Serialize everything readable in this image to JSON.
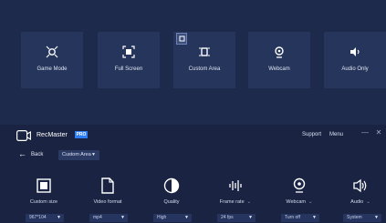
{
  "modes": [
    {
      "label": "Game Mode",
      "icon": "gamepad-icon"
    },
    {
      "label": "Full Screen",
      "icon": "fullscreen-icon"
    },
    {
      "label": "Custom Area",
      "icon": "custom-area-icon"
    },
    {
      "label": "Webcam",
      "icon": "webcam-icon"
    },
    {
      "label": "Audio Only",
      "icon": "speaker-icon"
    }
  ],
  "app": {
    "name": "RecMaster",
    "badge": "PRO",
    "support": "Support",
    "menu": "Menu",
    "minimize": "—",
    "close": "✕"
  },
  "nav": {
    "back_label": "Back",
    "area_select": "Custom Area"
  },
  "tools": [
    {
      "label": "Custom size",
      "value": "967*104",
      "has_chevron": false
    },
    {
      "label": "Video format",
      "value": "mp4",
      "has_chevron": false
    },
    {
      "label": "Quality",
      "value": "High",
      "has_chevron": false
    },
    {
      "label": "Frame rate",
      "value": "24 fps",
      "has_chevron": true
    },
    {
      "label": "Webcam",
      "value": "Turn off",
      "has_chevron": true
    },
    {
      "label": "Audio",
      "value": "System",
      "has_chevron": true
    }
  ],
  "colors": {
    "background": "#1d2a4b",
    "card": "#26355c",
    "accent": "#2e7cf6"
  }
}
